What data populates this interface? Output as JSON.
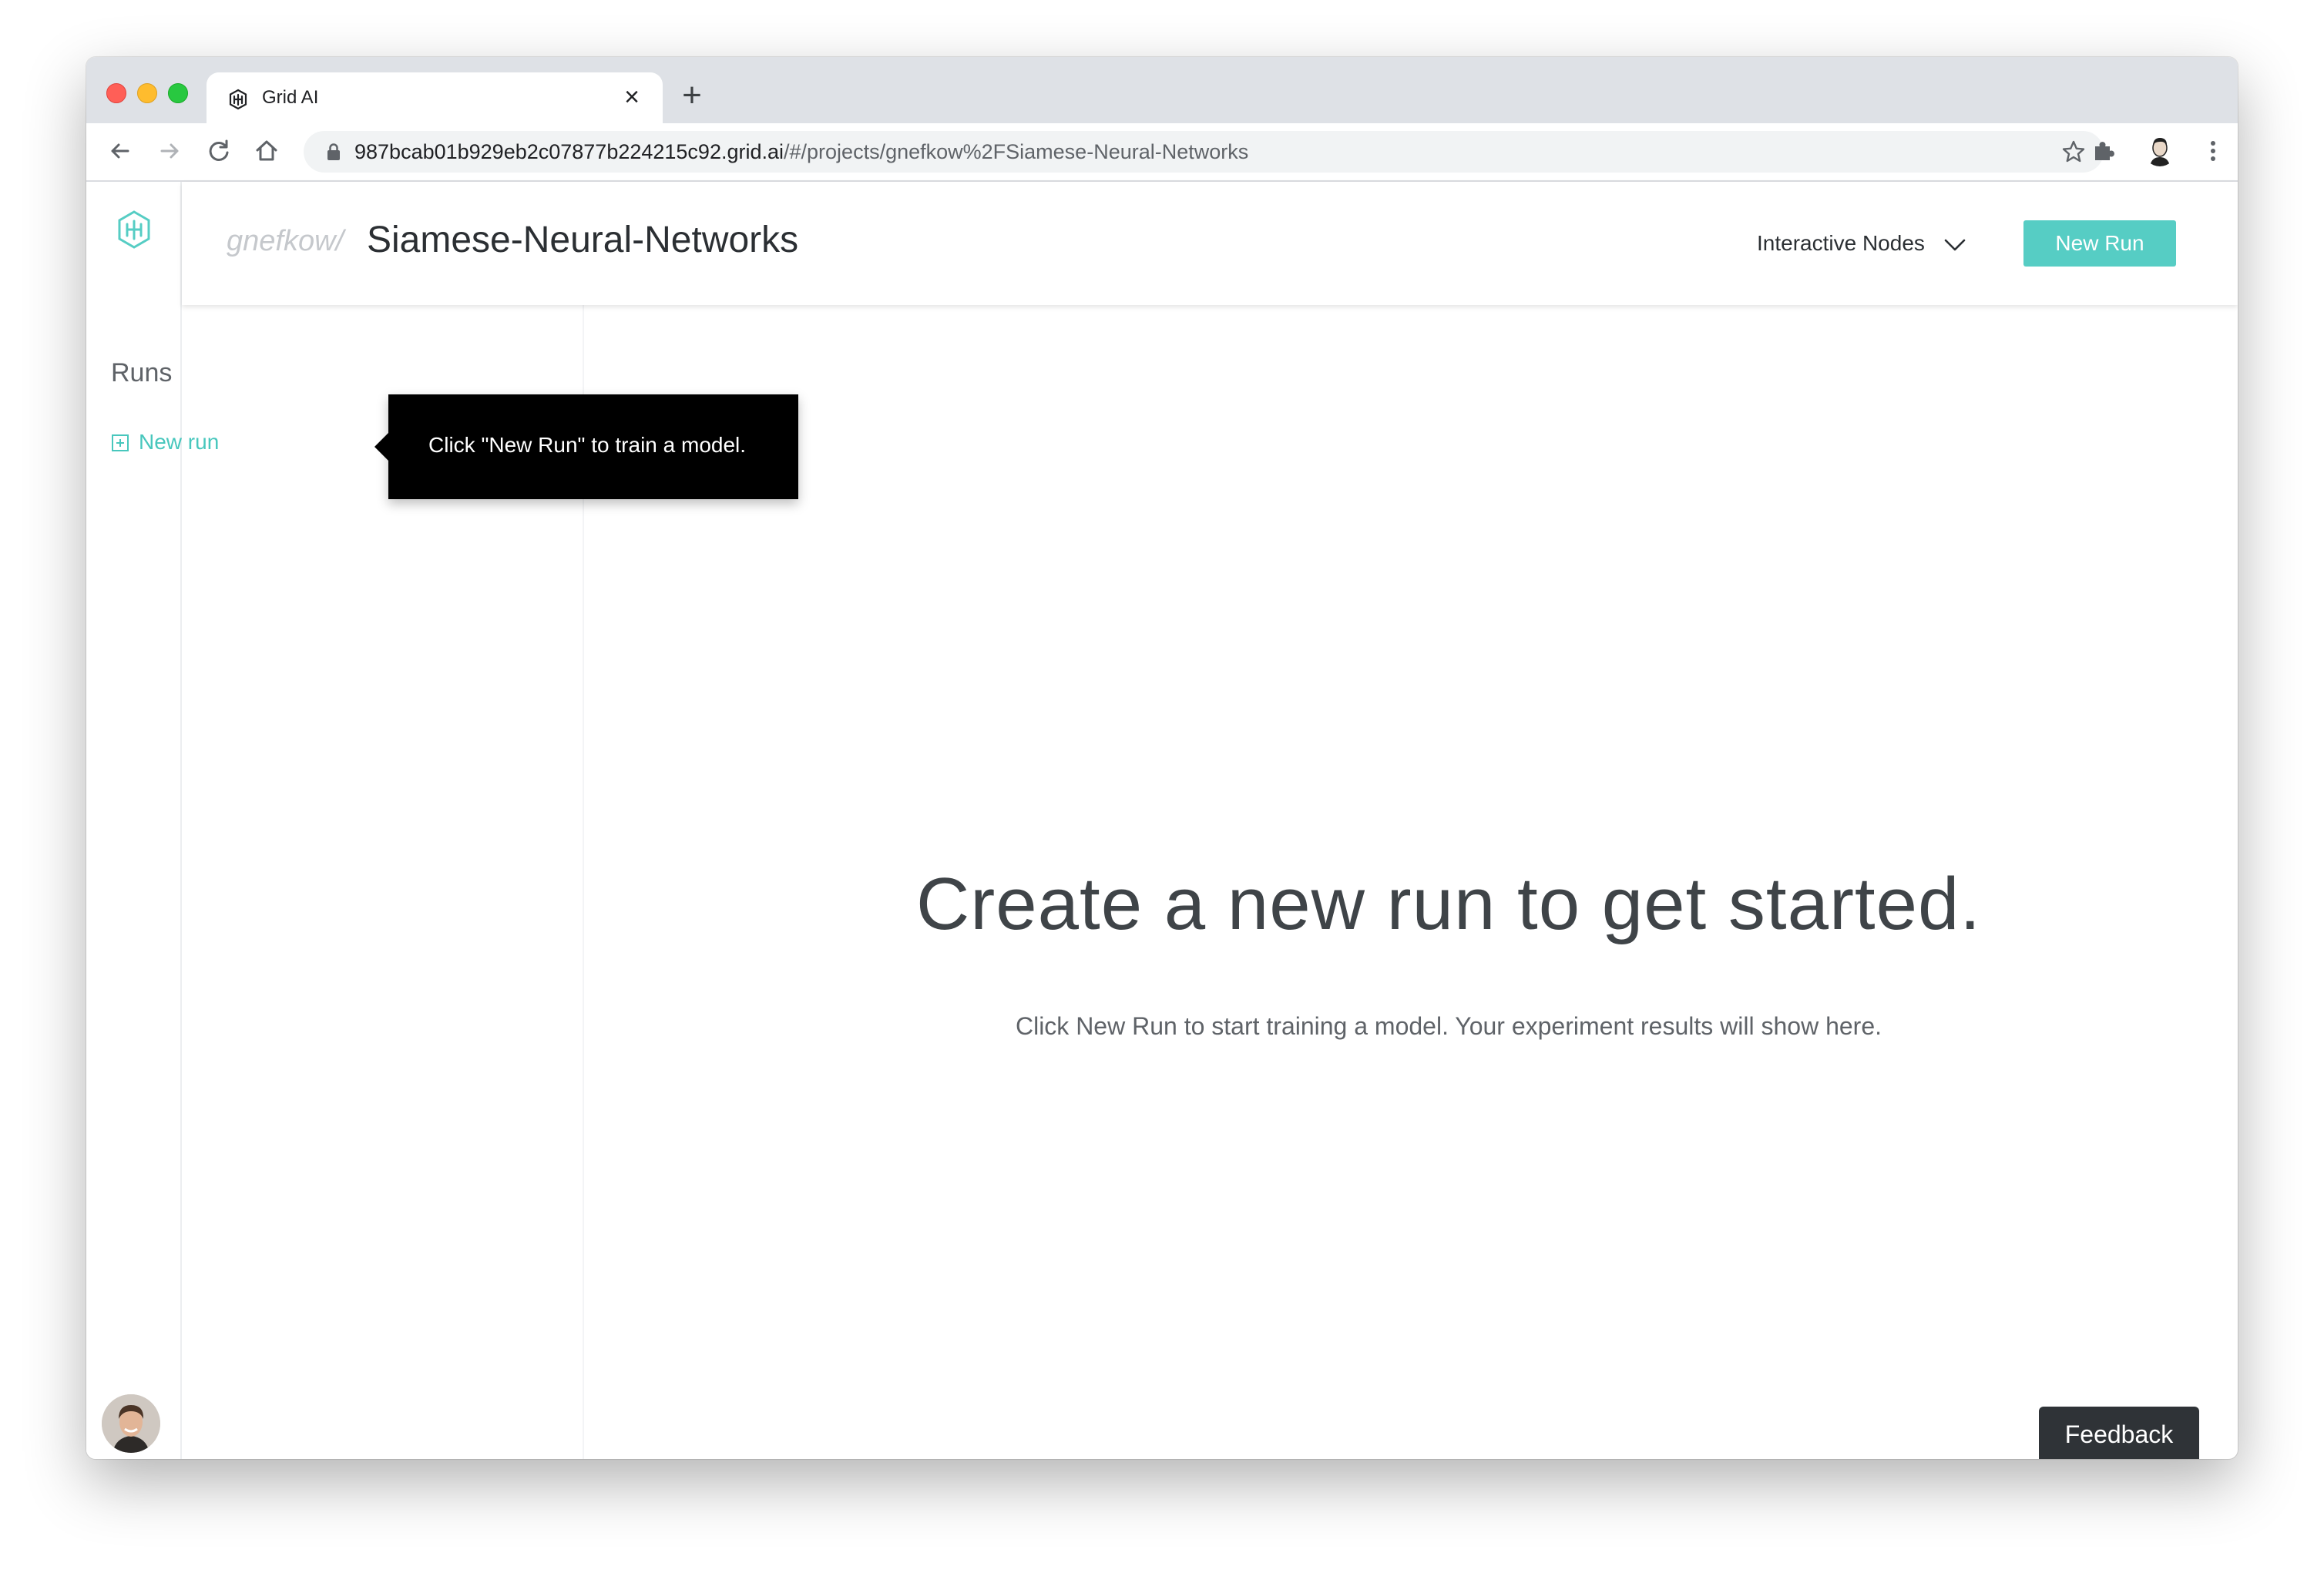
{
  "browser": {
    "tab_title": "Grid AI",
    "tab_close_label": "×",
    "new_tab_label": "+",
    "url_host": "987bcab01b929eb2c07877b224215c92.grid.ai",
    "url_path": "/#/projects/gnefkow%2FSiamese-Neural-Networks"
  },
  "header": {
    "owner": "gnefkow/",
    "project": "Siamese-Neural-Networks",
    "nodes_menu": "Interactive Nodes",
    "new_run_button": "New Run"
  },
  "runs": {
    "title": "Runs",
    "new_run_link": "New run"
  },
  "tooltip": {
    "text": "Click \"New Run\" to train a model."
  },
  "empty_state": {
    "title": "Create a new run to get started.",
    "subtitle": "Click New Run to start training a model. Your experiment results will show here."
  },
  "feedback": {
    "label": "Feedback"
  },
  "icons": {
    "tab_favicon": "grid-logo-icon",
    "rail_logo": "grid-logo-icon",
    "back": "arrow-left-icon",
    "forward": "arrow-right-icon",
    "reload": "reload-icon",
    "home": "home-icon",
    "lock": "lock-icon",
    "bookmark": "star-icon",
    "extensions": "puzzle-icon",
    "profile": "profile-avatar",
    "menu": "kebab-menu-icon",
    "dropdown": "chevron-down-icon",
    "new_run_link": "plus-box-icon"
  },
  "colors": {
    "accent": "#56cdc4",
    "link": "#48c7bd",
    "tooltip_bg": "#000000",
    "feedback_bg": "#2f3337",
    "title_text": "#3f4448"
  }
}
